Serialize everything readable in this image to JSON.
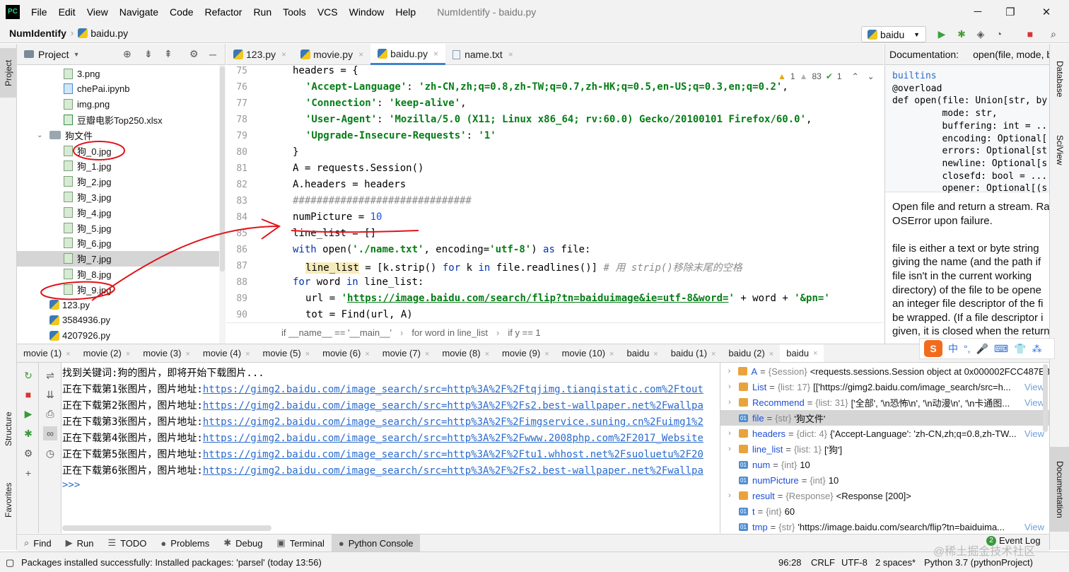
{
  "menu": {
    "logo_text": "PC",
    "items": [
      "File",
      "Edit",
      "View",
      "Navigate",
      "Code",
      "Refactor",
      "Run",
      "Tools",
      "VCS",
      "Window",
      "Help"
    ],
    "title": "NumIdentify - baidu.py",
    "window_controls": [
      "─",
      "❐",
      "✕"
    ]
  },
  "nav": {
    "project": "NumIdentify",
    "file": "baidu.py",
    "run_config": "baidu",
    "run_config_arrow": "▼"
  },
  "toolbar_icons": [
    "play-icon",
    "debug-icon",
    "coverage-icon",
    "profile-icon",
    "stop-icon",
    "search-icon"
  ],
  "left_strip": {
    "project": "Project",
    "structure": "Structure",
    "favorites": "Favorites"
  },
  "right_strip": {
    "database": "Database",
    "sciview": "SciView",
    "documentation": "Documentation"
  },
  "project_panel": {
    "title": "Project",
    "title_arrow": "▼",
    "items": [
      {
        "label": "3.png",
        "icon": "img"
      },
      {
        "label": "chePai.ipynb",
        "icon": "nb"
      },
      {
        "label": "img.png",
        "icon": "img"
      },
      {
        "label": "豆瓣电影Top250.xlsx",
        "icon": "xls"
      },
      {
        "label": "狗文件",
        "icon": "folder"
      },
      {
        "label": "狗_0.jpg",
        "icon": "img"
      },
      {
        "label": "狗_1.jpg",
        "icon": "img"
      },
      {
        "label": "狗_2.jpg",
        "icon": "img"
      },
      {
        "label": "狗_3.jpg",
        "icon": "img"
      },
      {
        "label": "狗_4.jpg",
        "icon": "img"
      },
      {
        "label": "狗_5.jpg",
        "icon": "img"
      },
      {
        "label": "狗_6.jpg",
        "icon": "img"
      },
      {
        "label": "狗_7.jpg",
        "icon": "img"
      },
      {
        "label": "狗_8.jpg",
        "icon": "img"
      },
      {
        "label": "狗_9.jpg",
        "icon": "img"
      },
      {
        "label": "123.py",
        "icon": "py"
      },
      {
        "label": "3584936.py",
        "icon": "py"
      },
      {
        "label": "4207926.py",
        "icon": "py"
      }
    ]
  },
  "editor_tabs": [
    {
      "label": "123.py",
      "close": "×"
    },
    {
      "label": "movie.py",
      "close": "×"
    },
    {
      "label": "baidu.py",
      "close": "×"
    },
    {
      "label": "name.txt",
      "close": "×"
    }
  ],
  "inspection": {
    "warnings": "1",
    "weak_warnings": "83",
    "typos": "1",
    "warn_icon": "▲",
    "weak_icon": "▲",
    "ok_icon": "✔",
    "up": "⌃",
    "down": "⌄"
  },
  "editor": {
    "line_numbers": [
      "75",
      "76",
      "77",
      "78",
      "79",
      "80",
      "81",
      "82",
      "83",
      "84",
      "85",
      "86",
      "87",
      "88",
      "89",
      "90"
    ],
    "code": {
      "l75": "headers = {",
      "l76_key": "'Accept-Language'",
      "l76_val": "'zh-CN,zh;q=0.8,zh-TW;q=0.7,zh-HK;q=0.5,en-US;q=0.3,en;q=0.2'",
      "l77_key": "'Connection'",
      "l77_val": "'keep-alive'",
      "l78_key": "'User-Agent'",
      "l78_val": "'Mozilla/5.0 (X11; Linux x86_64; rv:60.0) Gecko/20100101 Firefox/60.0'",
      "l79_key": "'Upgrade-Insecure-Requests'",
      "l79_val": "'1'",
      "l80": "}",
      "l81": "A = requests.Session()",
      "l82": "A.headers = headers",
      "l83": "##############################",
      "l84_var": "numPicture = ",
      "l84_num": "10",
      "l85": "line_list = []",
      "l86_kw": "with",
      "l86_mid": " open(",
      "l86_str": "'./name.txt'",
      "l86_enc": ", encoding=",
      "l86_encval": "'utf-8'",
      "l86_close": ") ",
      "l86_as": "as",
      "l86_end": " file:",
      "l87_var": "line_list",
      "l87_mid": " = [k.strip() ",
      "l87_for": "for",
      "l87_k": " k ",
      "l87_in": "in",
      "l87_end": " file.readlines()] ",
      "l87_cmt": "# 用 strip()移除末尾的空格",
      "l88_for": "for",
      "l88_word": " word ",
      "l88_in": "in",
      "l88_end": " line_list:",
      "l89_pre": "url = ",
      "l89_q1": "'",
      "l89_url": "https://image.baidu.com/search/flip?tn=baiduimage&ie=utf-8&word=",
      "l89_q2": "'",
      "l89_mid": " + word + ",
      "l89_pn": "'&pn='",
      "l90": "tot = Find(url, A)"
    }
  },
  "breadcrumb": [
    "if __name__ == '__main__'",
    "for word in line_list",
    "if y == 1"
  ],
  "breadcrumb_sep": "›",
  "doc": {
    "header_label": "Documentation:",
    "header_value": "open(file, mode, b",
    "sig": [
      "builtins",
      "@overload",
      "def open(file: Union[str, by",
      "         mode: str,",
      "         buffering: int = ...",
      "         encoding: Optional[",
      "         errors: Optional[st",
      "         newline: Optional[s",
      "         closefd: bool = ...",
      "         opener: Optional[(s"
    ],
    "text": [
      "Open file and return a stream. Ra",
      "OSError upon failure.",
      "",
      "file is either a text or byte string",
      "giving the name (and the path if",
      "file isn't in the current working",
      "directory) of the file to be opene",
      "an integer file descriptor of the fi",
      "be wrapped. (If a file descriptor i",
      "given, it is closed when the return"
    ]
  },
  "run_tabs": [
    "movie (1)",
    "movie (2)",
    "movie (3)",
    "movie (4)",
    "movie (5)",
    "movie (6)",
    "movie (7)",
    "movie (8)",
    "movie (9)",
    "movie (10)",
    "baidu",
    "baidu (1)",
    "baidu (2)",
    "baidu"
  ],
  "run_tab_close": "×",
  "console": {
    "line0": "找到关键词:狗的图片，即将开始下载图片...",
    "downloads": [
      {
        "prefix": "正在下载第1张图片，图片地址:",
        "url": "https://gimg2.baidu.com/image_search/src=http%3A%2F%2Ftqjimg.tianqistatic.com%2Ftout"
      },
      {
        "prefix": "正在下载第2张图片，图片地址:",
        "url": "https://gimg2.baidu.com/image_search/src=http%3A%2F%2Fs2.best-wallpaper.net%2Fwallpa"
      },
      {
        "prefix": "正在下载第3张图片，图片地址:",
        "url": "https://gimg2.baidu.com/image_search/src=http%3A%2F%2Fimgservice.suning.cn%2Fuimg1%2"
      },
      {
        "prefix": "正在下载第4张图片，图片地址:",
        "url": "https://gimg2.baidu.com/image_search/src=http%3A%2F%2Fwww.2008php.com%2F2017_Website"
      },
      {
        "prefix": "正在下载第5张图片，图片地址:",
        "url": "https://gimg2.baidu.com/image_search/src=http%3A%2F%2Ftu1.whhost.net%2Fsuoluetu%2F20"
      },
      {
        "prefix": "正在下载第6张图片，图片地址:",
        "url": "https://gimg2.baidu.com/image_search/src=http%3A%2F%2Fs2.best-wallpaper.net%2Fwallpa"
      }
    ],
    "prompt": ">>>"
  },
  "variables": [
    {
      "name": "A",
      "type": "{Session}",
      "value": "<requests.sessions.Session object at 0x000002FCC487E3",
      "kind": "obj",
      "expand": true,
      "view": ""
    },
    {
      "name": "List",
      "type": "{list: 17}",
      "value": "[['https://gimg2.baidu.com/image_search/src=h...",
      "kind": "obj",
      "expand": true,
      "view": "View"
    },
    {
      "name": "Recommend",
      "type": "{list: 31}",
      "value": "['全部', '\\n恐怖\\n', '\\n动漫\\n', '\\n卡通图...",
      "kind": "obj",
      "expand": true,
      "view": "View"
    },
    {
      "name": "file",
      "type": "{str}",
      "value": "'狗文件'",
      "kind": "prim",
      "expand": false,
      "view": ""
    },
    {
      "name": "headers",
      "type": "{dict: 4}",
      "value": "{'Accept-Language': 'zh-CN,zh;q=0.8,zh-TW...",
      "kind": "obj",
      "expand": true,
      "view": "View"
    },
    {
      "name": "line_list",
      "type": "{list: 1}",
      "value": "['狗']",
      "kind": "obj",
      "expand": true,
      "view": ""
    },
    {
      "name": "num",
      "type": "{int}",
      "value": "10",
      "kind": "prim",
      "expand": false,
      "view": ""
    },
    {
      "name": "numPicture",
      "type": "{int}",
      "value": "10",
      "kind": "prim",
      "expand": false,
      "view": ""
    },
    {
      "name": "result",
      "type": "{Response}",
      "value": "<Response [200]>",
      "kind": "obj",
      "expand": true,
      "view": ""
    },
    {
      "name": "t",
      "type": "{int}",
      "value": "60",
      "kind": "prim",
      "expand": false,
      "view": ""
    },
    {
      "name": "tmp",
      "type": "{str}",
      "value": "'https://image.baidu.com/search/flip?tn=baiduima...",
      "kind": "prim",
      "expand": false,
      "view": "View"
    }
  ],
  "bottom_tools": [
    {
      "label": "Find",
      "icon": "⌕"
    },
    {
      "label": "Run",
      "icon": "▶"
    },
    {
      "label": "TODO",
      "icon": "☰"
    },
    {
      "label": "Problems",
      "icon": "●"
    },
    {
      "label": "Debug",
      "icon": "✱"
    },
    {
      "label": "Terminal",
      "icon": "▣"
    },
    {
      "label": "Python Console",
      "icon": "●"
    }
  ],
  "event_log": {
    "badge": "2",
    "label": "Event Log"
  },
  "status": {
    "message": "Packages installed successfully: Installed packages: 'parsel' (today 13:56)",
    "position": "96:28",
    "line_sep": "CRLF",
    "encoding": "UTF-8",
    "indent": "2 spaces*",
    "interpreter": "Python 3.7 (pythonProject)"
  },
  "ime": {
    "logo": "S",
    "lang": "中",
    "punct": "°,",
    "icons": [
      "🎤",
      "⌨",
      "👕",
      "⁂"
    ]
  },
  "watermark": "@稀土掘金技术社区"
}
